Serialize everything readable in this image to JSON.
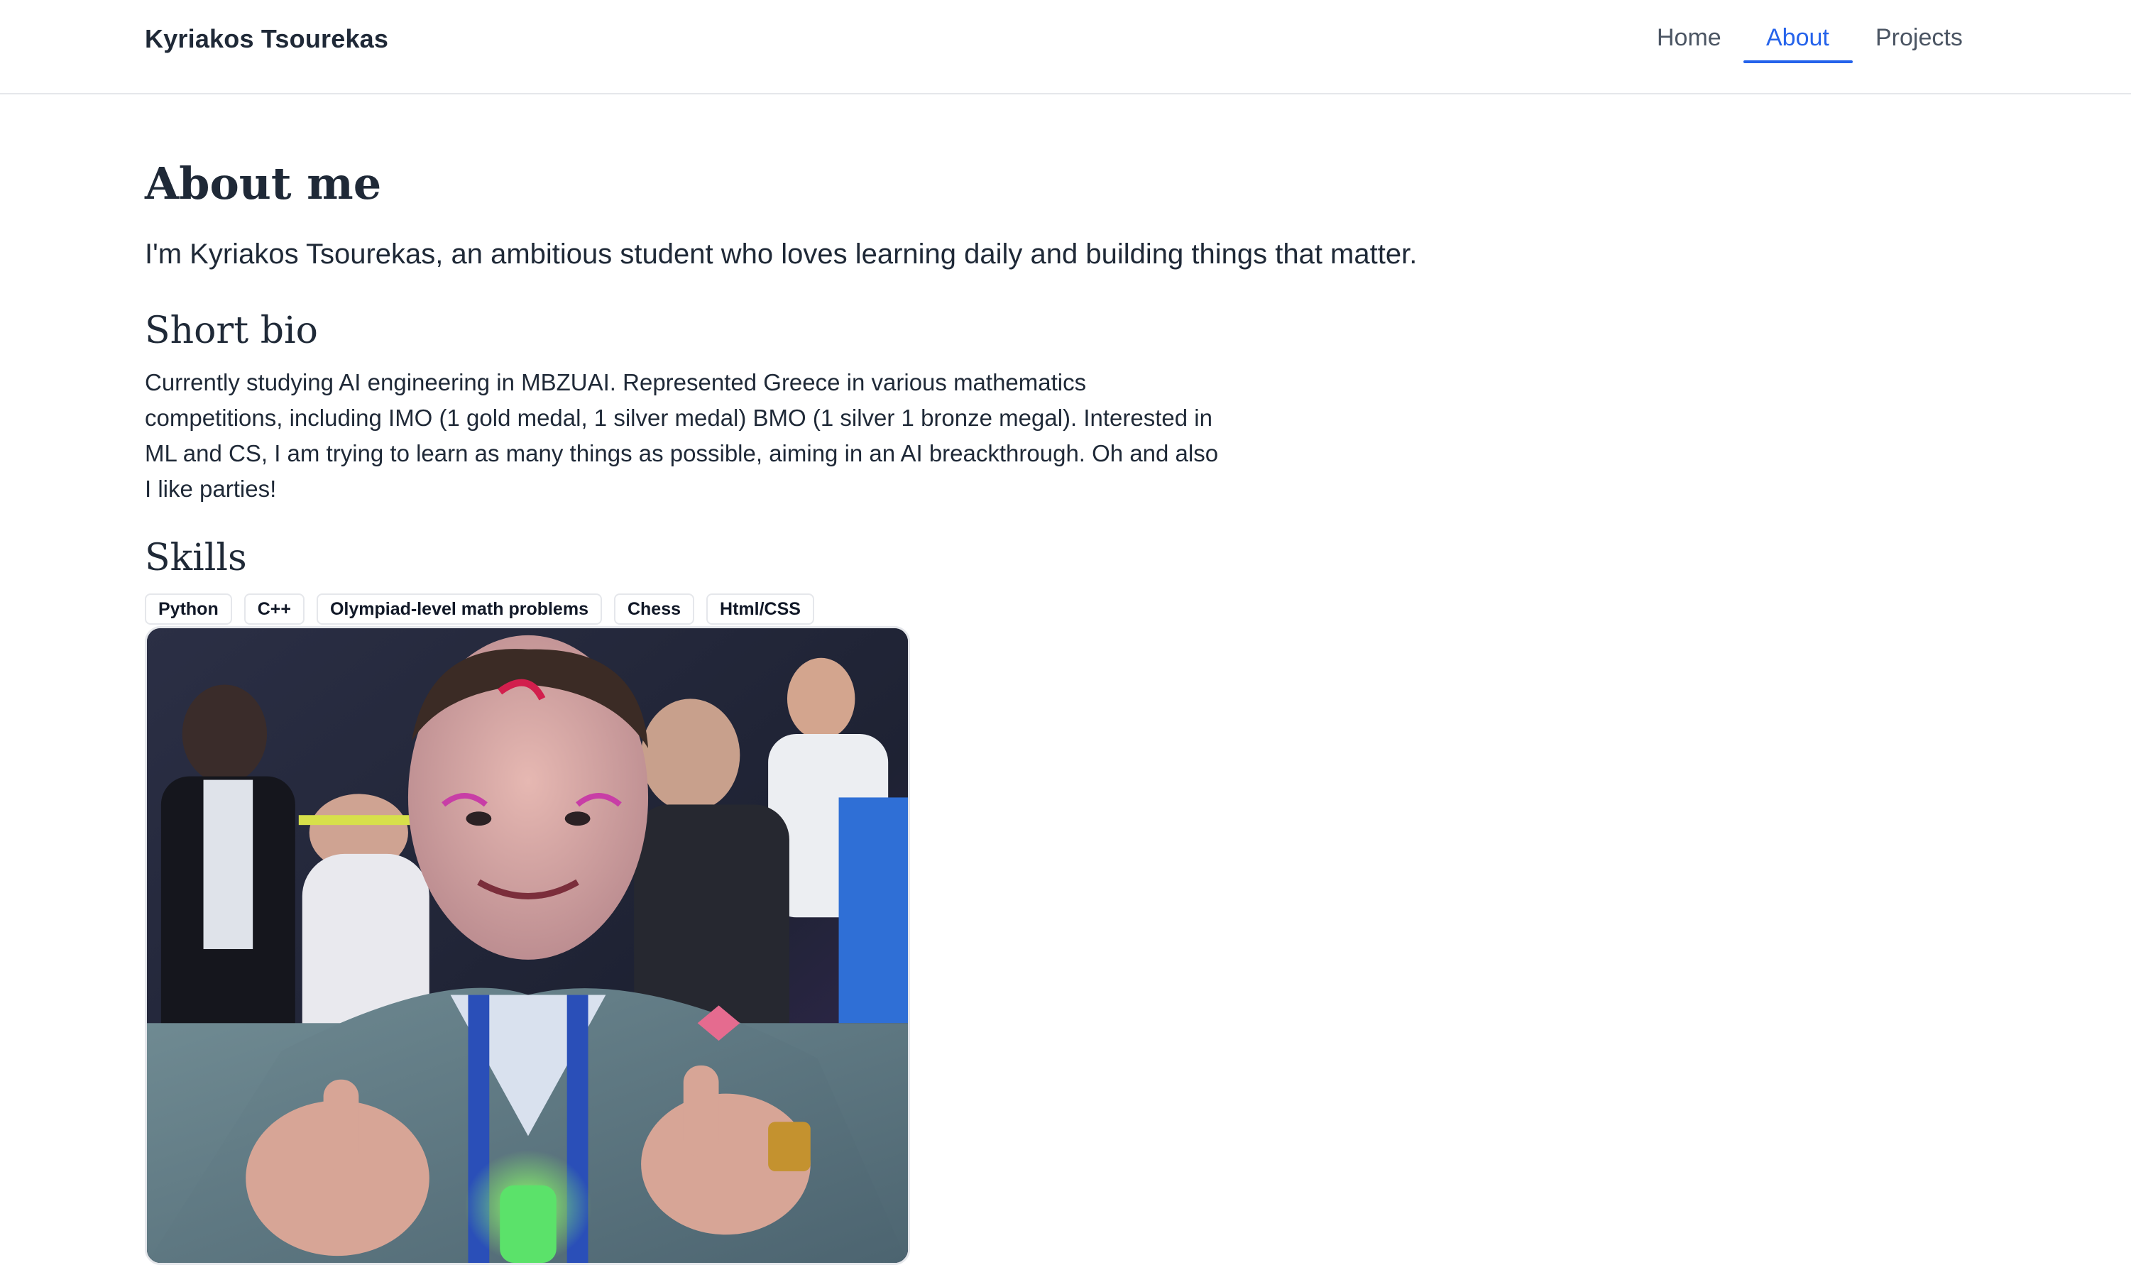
{
  "header": {
    "brand": "Kyriakos Tsourekas",
    "nav": [
      {
        "label": "Home",
        "active": false
      },
      {
        "label": "About",
        "active": true
      },
      {
        "label": "Projects",
        "active": false
      }
    ],
    "active_color": "#2563eb"
  },
  "main": {
    "title": "About me",
    "lead": "I'm Kyriakos Tsourekas, an ambitious student who loves learning daily and building things that matter.",
    "bio_heading": "Short bio",
    "bio_text": "Currently studying AI engineering in MBZUAI. Represented Greece in various mathematics competitions, including IMO (1 gold medal, 1 silver medal) BMO (1 silver 1 bronze megal). Interested in ML and CS, I am trying to learn as many things as possible, aiming in an AI breackthrough. Oh and also I like parties!",
    "skills_heading": "Skills",
    "skills": [
      "Python",
      "C++",
      "Olympiad-level math problems",
      "Chess",
      "Html/CSS"
    ]
  }
}
